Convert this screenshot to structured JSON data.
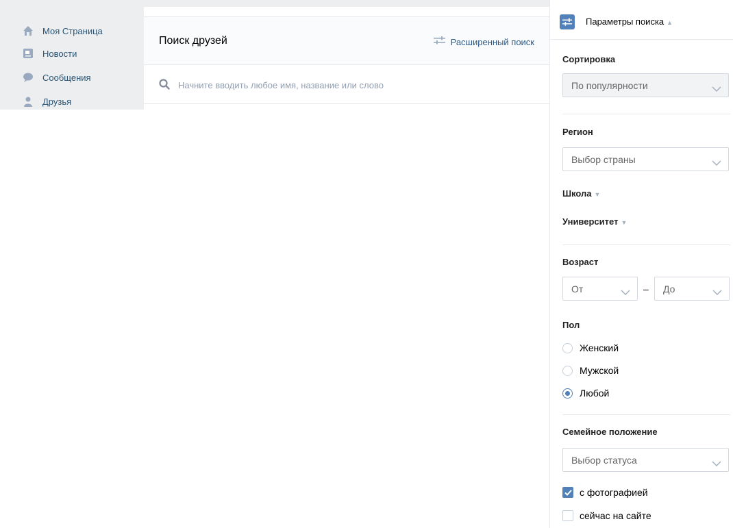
{
  "sidebar": {
    "items": [
      {
        "label": "Моя Страница",
        "icon": "home-icon"
      },
      {
        "label": "Новости",
        "icon": "news-icon"
      },
      {
        "label": "Сообщения",
        "icon": "messages-icon"
      },
      {
        "label": "Друзья",
        "icon": "friends-icon"
      }
    ]
  },
  "main": {
    "title": "Поиск друзей",
    "advanced_search_label": "Расширенный поиск",
    "search_placeholder": "Начните вводить любое имя, название или слово",
    "search_value": ""
  },
  "filters": {
    "header_title": "Параметры поиска",
    "sort": {
      "label": "Сортировка",
      "value": "По популярности"
    },
    "region": {
      "label": "Регион",
      "value": "Выбор страны"
    },
    "school_label": "Школа",
    "university_label": "Университет",
    "age": {
      "label": "Возраст",
      "from": "От",
      "separator": "–",
      "to": "До"
    },
    "gender": {
      "label": "Пол",
      "options": [
        "Женский",
        "Мужской",
        "Любой"
      ],
      "selected": "Любой"
    },
    "marital": {
      "label": "Семейное положение",
      "value": "Выбор статуса"
    },
    "with_photo": {
      "label": "с фотографией",
      "checked": true
    },
    "online_now": {
      "label": "сейчас на сайте",
      "checked": false
    }
  },
  "colors": {
    "accent": "#5181b8",
    "link": "#2a5885",
    "sidebar_bg": "#edeef0",
    "placeholder": "#929eb0"
  }
}
